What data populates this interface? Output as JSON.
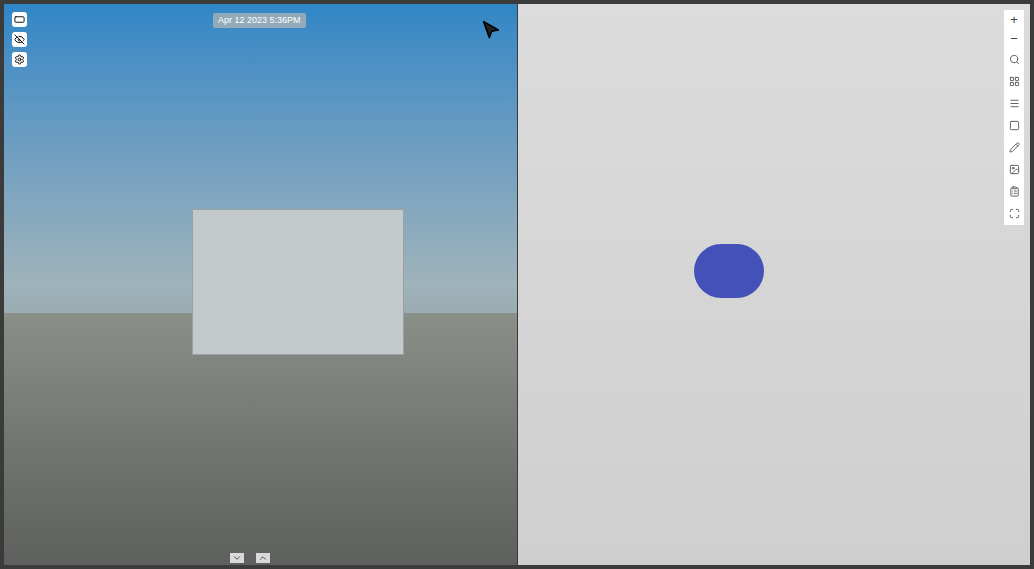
{
  "photo_view": {
    "timestamp": "Apr 12 2023 5:36PM"
  },
  "model_view": {
    "zoom_in": "+",
    "zoom_out": "−"
  }
}
